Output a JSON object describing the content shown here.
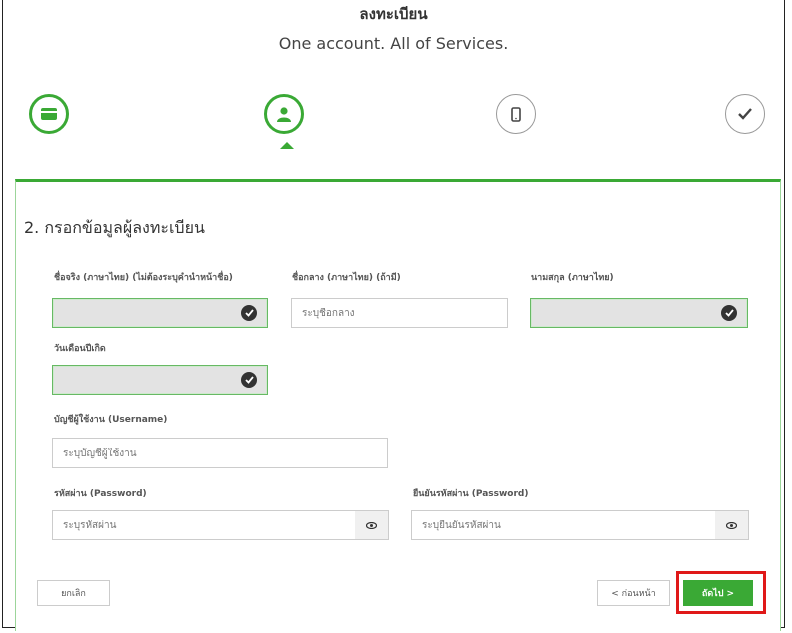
{
  "header": {
    "title": "ลงทะเบียน",
    "subtitle": "One account. All of Services."
  },
  "steps": [
    {
      "icon": "id-card-icon",
      "state": "done"
    },
    {
      "icon": "user-icon",
      "state": "active"
    },
    {
      "icon": "mobile-icon",
      "state": "todo"
    },
    {
      "icon": "checkmark-icon",
      "state": "todo"
    }
  ],
  "form": {
    "heading": "2. กรอกข้อมูลผู้ลงทะเบียน",
    "first_name": {
      "label": "ชื่อจริง (ภาษาไทย) (ไม่ต้องระบุคำนำหน้าชื่อ)",
      "value": ""
    },
    "middle_name": {
      "label": "ชื่อกลาง (ภาษาไทย) (ถ้ามี)",
      "placeholder": "ระบุชื่อกลาง"
    },
    "last_name": {
      "label": "นามสกุล (ภาษาไทย)",
      "value": ""
    },
    "birth_date": {
      "label": "วันเดือนปีเกิด",
      "value": ""
    },
    "username": {
      "label": "บัญชีผู้ใช้งาน (Username)",
      "placeholder": "ระบุบัญชีผู้ใช้งาน"
    },
    "password": {
      "label": "รหัสผ่าน (Password)",
      "placeholder": "ระบุรหัสผ่าน"
    },
    "confirm_password": {
      "label": "ยืนยันรหัสผ่าน (Password)",
      "placeholder": "ระบุยืนยันรหัสผ่าน"
    }
  },
  "buttons": {
    "cancel": "ยกเลิก",
    "back": "< ก่อนหน้า",
    "next": "ถัดไป >"
  },
  "colors": {
    "accent": "#3aa935",
    "highlight": "#e01818"
  }
}
